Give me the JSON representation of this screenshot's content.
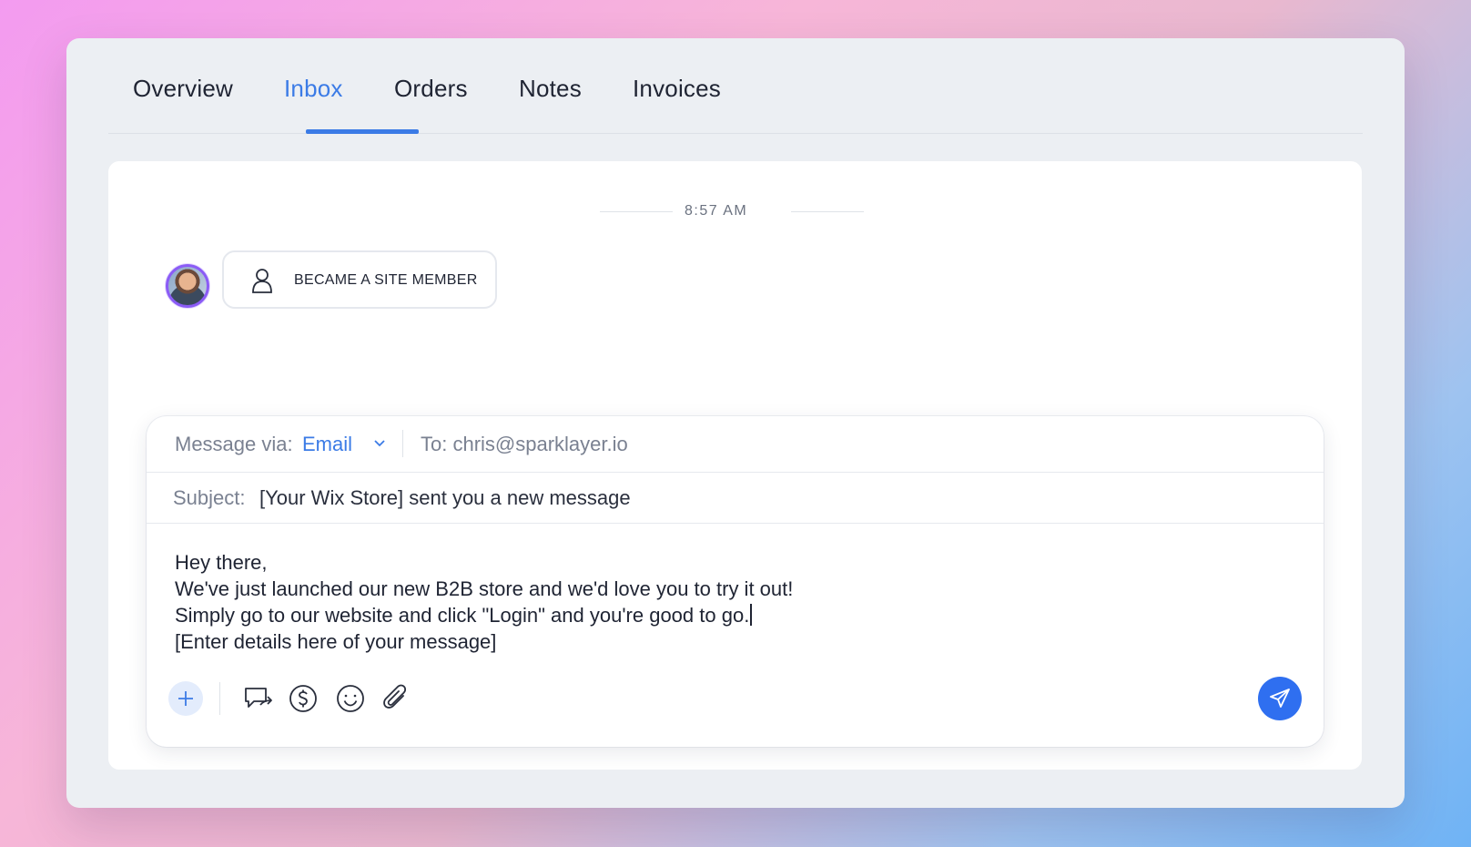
{
  "tabs": [
    {
      "label": "Overview",
      "active": false
    },
    {
      "label": "Inbox",
      "active": true
    },
    {
      "label": "Orders",
      "active": false
    },
    {
      "label": "Notes",
      "active": false
    },
    {
      "label": "Invoices",
      "active": false
    }
  ],
  "conversation": {
    "timestamp": "8:57 AM",
    "event": {
      "label": "BECAME A SITE MEMBER",
      "icon": "person-icon"
    }
  },
  "composer": {
    "via_label": "Message via:",
    "via_value": "Email",
    "to_label": "To: chris@sparklayer.io",
    "subject_label": "Subject:",
    "subject_value": "[Your Wix Store] sent you a new message",
    "body_lines": [
      "Hey there,",
      "We've just launched our new B2B store and we'd love you to try it out!",
      "Simply go to our website and click \"Login\" and you're good to go.",
      "[Enter details here of your message]"
    ],
    "toolbar_icons": [
      "plus-icon",
      "chat-forward-icon",
      "dollar-icon",
      "emoji-icon",
      "paperclip-icon",
      "send-icon"
    ]
  },
  "colors": {
    "accent": "#3b7be6",
    "send_button": "#2f6ff0",
    "window_bg": "#eceff3",
    "text": "#1f2433",
    "muted": "#7a8191"
  }
}
